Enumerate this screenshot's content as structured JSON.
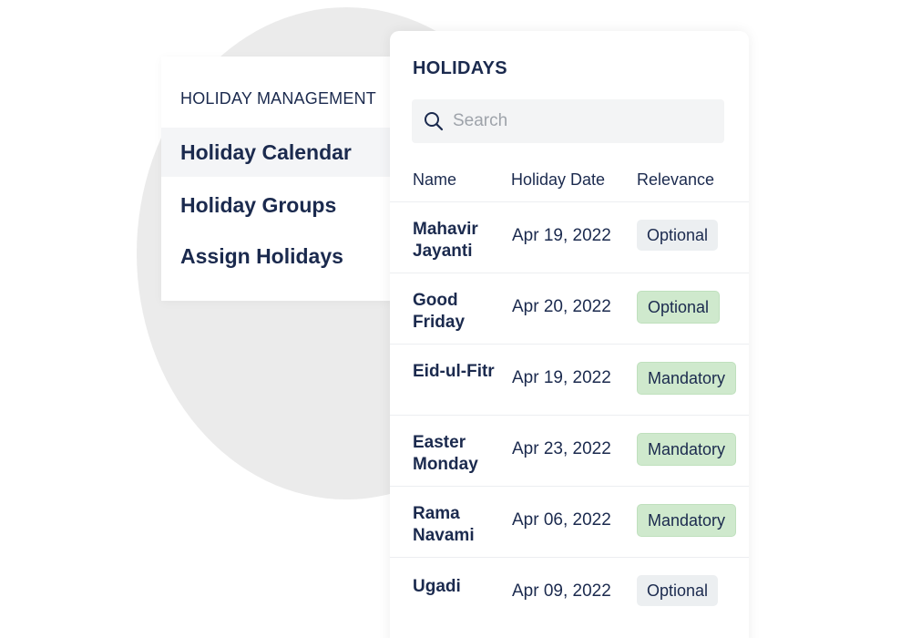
{
  "sidebar": {
    "heading": "HOLIDAY MANAGEMENT",
    "items": [
      {
        "label": "Holiday Calendar",
        "active": true
      },
      {
        "label": "Holiday Groups",
        "active": false
      },
      {
        "label": "Assign Holidays",
        "active": false
      }
    ]
  },
  "holidays": {
    "title": "HOLIDAYS",
    "search": {
      "placeholder": "Search",
      "value": "",
      "icon": "search-icon"
    },
    "columns": [
      "Name",
      "Holiday Date",
      "Relevance"
    ],
    "rows": [
      {
        "name": "Mahavir Jayanti",
        "date": "Apr 19, 2022",
        "relevance": "Optional",
        "badge_color": "#eceff1"
      },
      {
        "name": "Good Friday",
        "date": "Apr 20, 2022",
        "relevance": "Optional",
        "badge_color": "#cfe9cd"
      },
      {
        "name": "Eid-ul-Fitr",
        "date": "Apr 19, 2022",
        "relevance": "Mandatory",
        "badge_color": "#cfe9cd"
      },
      {
        "name": "Easter Monday",
        "date": "Apr 23, 2022",
        "relevance": "Mandatory",
        "badge_color": "#cfe9cd"
      },
      {
        "name": "Rama Navami",
        "date": "Apr 06, 2022",
        "relevance": "Mandatory",
        "badge_color": "#cfe9cd"
      },
      {
        "name": "Ugadi",
        "date": "Apr 09, 2022",
        "relevance": "Optional",
        "badge_color": "#eceff1"
      }
    ]
  },
  "colors": {
    "text": "#1b2a4e",
    "badge_grey": "#eceff1",
    "badge_green": "#cfe9cd",
    "backdrop_circle": "#ebebeb"
  }
}
